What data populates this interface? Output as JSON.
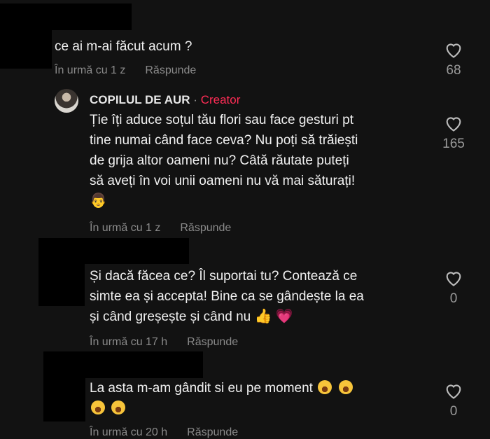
{
  "colors": {
    "background": "#121212",
    "creator_badge": "#fe2c55",
    "meta": "#8a8a8a"
  },
  "comments": [
    {
      "text": "ce ai m-ai făcut acum ?",
      "time": "În urmă cu 1 z",
      "reply": "Răspunde",
      "likes": "68"
    },
    {
      "author": "COPILUL DE AUR",
      "separator": "·",
      "badge": "Creator",
      "lines": [
        "Ție îți aduce soțul tău flori sau face gesturi pt",
        "tine numai când face ceva? Nu poți să trăiești",
        "de grija altor oameni nu? Câtă răutate puteți",
        "să aveți în voi unii oameni nu vă mai săturați!"
      ],
      "time": "În urmă cu 1 z",
      "reply": "Răspunde",
      "likes": "165",
      "emoji": "person-emoji"
    },
    {
      "lines": [
        "Și dacă făcea ce? Îl suportai tu? Contează ce",
        "simte ea și accepta! Bine ca se gândește la ea",
        "și când greșește și când nu"
      ],
      "time": "În urmă cu 17 h",
      "reply": "Răspunde",
      "likes": "0",
      "emojis": [
        "thumbs-up-emoji",
        "heart-emoji"
      ]
    },
    {
      "lines": [
        "La asta m-am gândit si eu pe moment"
      ],
      "time": "În urmă cu 20 h",
      "reply": "Răspunde",
      "likes": "0",
      "emojis": [
        "laughing-emoji",
        "laughing-emoji",
        "laughing-emoji",
        "laughing-emoji"
      ]
    }
  ]
}
